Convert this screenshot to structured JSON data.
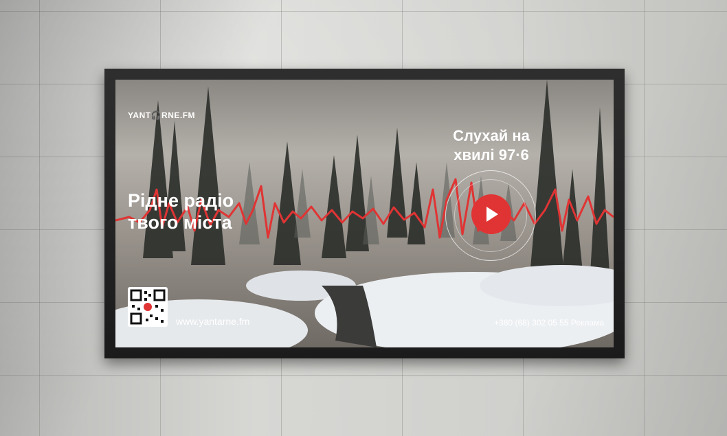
{
  "logo": {
    "pre": "YANT",
    "post": "RNE.FM"
  },
  "headline": {
    "line1": "Рідне радіо",
    "line2": "твого міста"
  },
  "tune": {
    "line1": "Слухай на",
    "line2": "хвилі 97·6"
  },
  "contact": {
    "url": "www.yantarne.fm",
    "phone": "+380 (68) 302 05 55 Реклама"
  },
  "colors": {
    "accent": "#e03434",
    "wall": "#d0d0cd",
    "frame": "#1f1f1f",
    "snow": "#e9ecef"
  },
  "icons": {
    "play": "play-icon",
    "headphones": "headphones-icon",
    "qr": "qr-code"
  }
}
